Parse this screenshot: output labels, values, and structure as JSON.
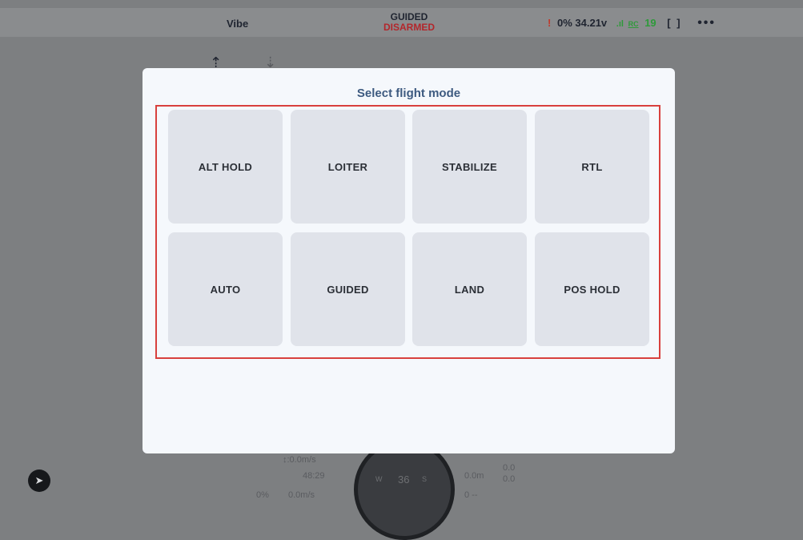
{
  "status_bar": {
    "vibe_label": "Vibe",
    "flight_mode": "GUIDED",
    "arm_state": "DISARMED",
    "battery_warn": "!",
    "battery_percent": "0%",
    "voltage": "34.21v",
    "signal_icon": "signal-bars-icon",
    "rc_label": "RC",
    "satellites": "19",
    "gps_icon": "gps-fix-icon",
    "more_icon": "more-dots-icon"
  },
  "background_overlay": {
    "home_icon": "takeoff-icon",
    "landing_icon": "landing-icon",
    "vertical_speed": "↕:0.0m/s",
    "time": "48:29",
    "throttle": "0%",
    "ground_speed": "0.0m/s",
    "altitude": "0.0m",
    "alt_top": "0.0",
    "alt_bottom": "0.0",
    "heading": "36",
    "compass_w": "W",
    "compass_s": "S",
    "distance": "0 --",
    "send_icon": "send-icon"
  },
  "modal": {
    "title": "Select flight mode",
    "modes": [
      "ALT HOLD",
      "LOITER",
      "STABILIZE",
      "RTL",
      "AUTO",
      "GUIDED",
      "LAND",
      "POS HOLD"
    ]
  },
  "colors": {
    "accent_title": "#3d5a80",
    "disarmed_red": "#b3262b",
    "highlight_border": "#d8403d",
    "signal_green": "#2e9a3a"
  }
}
